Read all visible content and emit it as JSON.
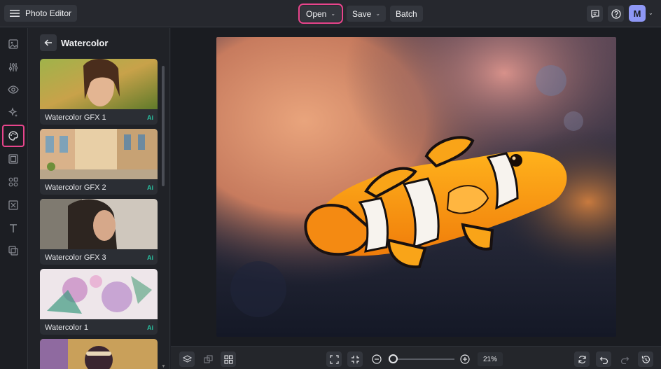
{
  "app": {
    "title": "Photo Editor"
  },
  "toolbar": {
    "open_label": "Open",
    "save_label": "Save",
    "batch_label": "Batch",
    "avatar_initial": "M"
  },
  "panel": {
    "title": "Watercolor",
    "items": [
      {
        "label": "Watercolor GFX 1",
        "badge": "Ai"
      },
      {
        "label": "Watercolor GFX 2",
        "badge": "Ai"
      },
      {
        "label": "Watercolor GFX 3",
        "badge": "Ai"
      },
      {
        "label": "Watercolor 1",
        "badge": "Ai"
      }
    ]
  },
  "zoom": {
    "value": "21%"
  },
  "colors": {
    "accent": "#e8458c",
    "ai_badge": "#27c3a1",
    "avatar": "#8e97f5"
  }
}
